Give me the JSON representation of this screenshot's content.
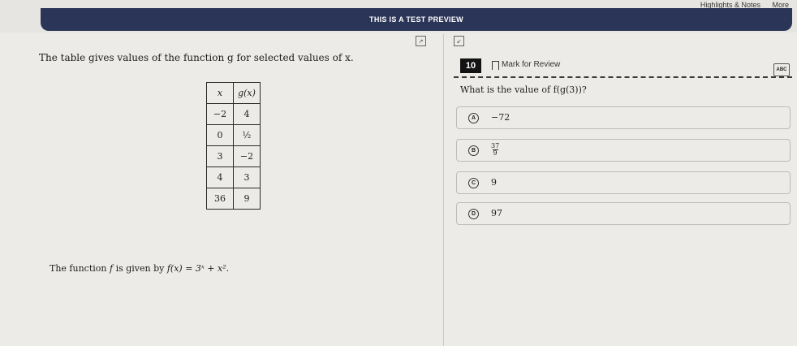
{
  "top_links": [
    "Highlights & Notes",
    "More"
  ],
  "banner": "THIS IS A TEST PREVIEW",
  "stem": "The table gives values of the function g for selected values of x.",
  "table": {
    "headers": [
      "x",
      "g(x)"
    ],
    "rows": [
      [
        "−2",
        "4"
      ],
      [
        "0",
        "½"
      ],
      [
        "3",
        "−2"
      ],
      [
        "4",
        "3"
      ],
      [
        "36",
        "9"
      ]
    ]
  },
  "fn_def": {
    "prefix": "The function",
    "f": "f",
    "mid": "is given by",
    "expr": "f(x) = 3ˣ + x²."
  },
  "question_number": "10",
  "mark_for_review": "Mark for Review",
  "abc_label": "ABC",
  "question": "What is the value of f(g(3))?",
  "choices": [
    {
      "letter": "A",
      "text": "−72"
    },
    {
      "letter": "B",
      "num": "37",
      "den": "9"
    },
    {
      "letter": "C",
      "text": "9"
    },
    {
      "letter": "D",
      "text": "97"
    }
  ]
}
